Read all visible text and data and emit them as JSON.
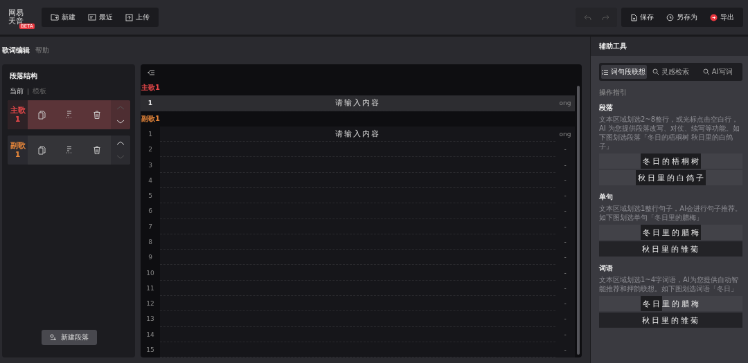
{
  "logo": {
    "line_1": "网易",
    "line_2": "天音",
    "badge": "BETA"
  },
  "file_actions": [
    {
      "label": "新建"
    },
    {
      "label": "最近"
    },
    {
      "label": "上传"
    }
  ],
  "history": [
    {
      "disabled": true
    },
    {
      "disabled": true
    }
  ],
  "save_actions": [
    {
      "label": "保存"
    },
    {
      "label": "另存为"
    },
    {
      "label": "导出"
    }
  ],
  "page_tabs": [
    {
      "label": "歌词编辑",
      "selected": true
    },
    {
      "label": "帮助",
      "selected": false
    }
  ],
  "structure": {
    "title": "段落结构",
    "modes": [
      {
        "label": "当前",
        "selected": true
      },
      {
        "label": "模板",
        "selected": false
      }
    ],
    "sections": [
      {
        "name": "主歌",
        "number": "1",
        "color": "#e8484a",
        "selected": true,
        "can_move_up": false,
        "can_move_down": true
      },
      {
        "name": "副歌",
        "number": "1",
        "color": "#e8873a",
        "selected": false,
        "can_move_up": true,
        "can_move_down": false
      }
    ],
    "add_button": "新建段落"
  },
  "editor": {
    "sections": [
      {
        "name": "主歌1",
        "color": "#e8484a",
        "lines": [
          {
            "number": "1",
            "placeholder": "请输入内容",
            "rhyme": "ong",
            "selected": true
          }
        ]
      },
      {
        "name": "副歌1",
        "color": "#e8873a",
        "lines": [
          {
            "number": "1",
            "placeholder": "请输入内容",
            "rhyme": "ong",
            "selected": false
          },
          {
            "number": "2",
            "rhyme": "-",
            "selected": false
          },
          {
            "number": "3",
            "rhyme": "-",
            "selected": false
          },
          {
            "number": "4",
            "rhyme": "-",
            "selected": false
          },
          {
            "number": "5",
            "rhyme": "-",
            "selected": false
          },
          {
            "number": "6",
            "rhyme": "-",
            "selected": false
          },
          {
            "number": "7",
            "rhyme": "-",
            "selected": false
          },
          {
            "number": "8",
            "rhyme": "-",
            "selected": false
          },
          {
            "number": "9",
            "rhyme": "-",
            "selected": false
          },
          {
            "number": "10",
            "rhyme": "-",
            "selected": false
          },
          {
            "number": "11",
            "rhyme": "-",
            "selected": false
          },
          {
            "number": "12",
            "rhyme": "-",
            "selected": false
          },
          {
            "number": "13",
            "rhyme": "-",
            "selected": false
          },
          {
            "number": "14",
            "rhyme": "-",
            "selected": false
          },
          {
            "number": "15",
            "rhyme": "-",
            "selected": false
          }
        ]
      }
    ]
  },
  "assist": {
    "title": "辅助工具",
    "tabs": [
      {
        "label": "词句段联想",
        "selected": true
      },
      {
        "label": "灵感检索",
        "selected": false
      },
      {
        "label": "AI写词",
        "selected": false
      }
    ],
    "guide_title": "操作指引",
    "guides": [
      {
        "title": "段落",
        "description": "文本区域划选2~8整行，或光标点击空白行，AI 为您提供段落改写、对仗、续写等功能。如下图划选段落「冬日的梧桐树 秋日里的白鸽子」",
        "example": [
          {
            "selected": false,
            "segments": [
              {
                "text": "冬日的梧桐树",
                "selected": true
              }
            ]
          },
          {
            "selected": false,
            "segments": [
              {
                "text": "秋日里的白鸽子",
                "selected": true
              }
            ]
          }
        ]
      },
      {
        "title": "单句",
        "description": "文本区域划选1整行句子，AI会进行句子推荐。如下图划选单句「冬日里的腊梅」",
        "example": [
          {
            "selected": false,
            "segments": [
              {
                "text": "冬日里的腊梅",
                "selected": true
              }
            ]
          },
          {
            "selected": true,
            "segments": [
              {
                "text": "秋日里的雏菊",
                "selected": false
              }
            ]
          }
        ]
      },
      {
        "title": "词语",
        "description": "文本区域划选1~4字词语，AI为您提供自动智能推荐和押韵联想。如下图划选词语「冬日」",
        "example": [
          {
            "selected": false,
            "segments": [
              {
                "text": "冬日",
                "selected": true
              },
              {
                "text": "里的腊梅",
                "selected": false
              }
            ]
          },
          {
            "selected": true,
            "segments": [
              {
                "text": "秋日里的雏菊",
                "selected": false
              }
            ]
          }
        ]
      }
    ]
  }
}
